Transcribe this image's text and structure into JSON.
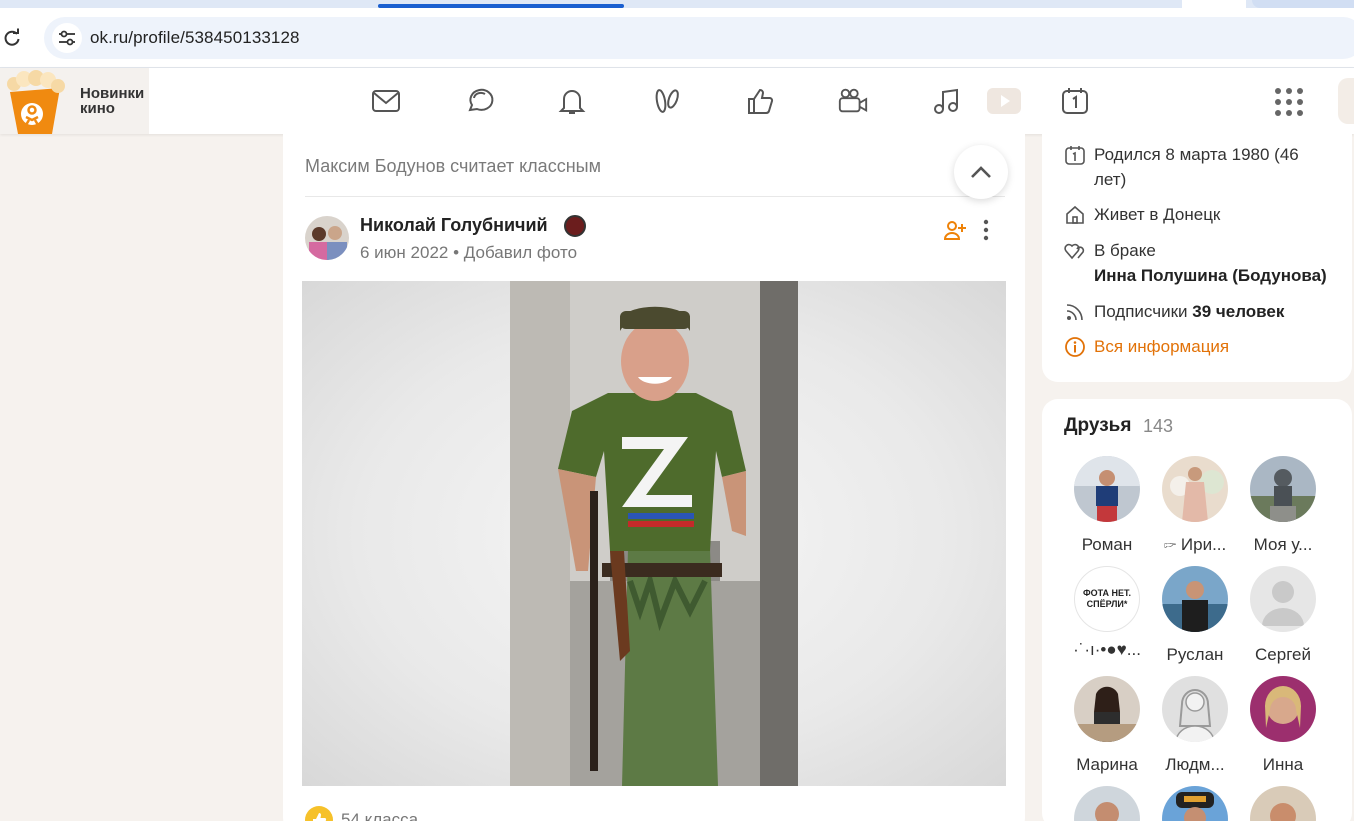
{
  "browser": {
    "url": "ok.ru/profile/538450133128"
  },
  "header": {
    "promo_text": "Новинки кино",
    "nav": [
      "messages-icon",
      "discussions-icon",
      "notifications-icon",
      "guests-icon",
      "likes-icon",
      "videocalls-icon",
      "music-icon",
      "video-icon",
      "calendar-icon",
      "apps-grid-icon"
    ]
  },
  "feed": {
    "liked_by": "Максим Бодунов считает классным",
    "author": "Николай Голубничий",
    "date": "6 июн 2022",
    "separator": "•",
    "action": "Добавил фото",
    "likes": "54 класса",
    "shirt_text": "Z"
  },
  "profile_info": {
    "born": "Родился 8 марта 1980 (46 лет)",
    "lives": "Живет в Донецк",
    "status": "В браке",
    "spouse": "Инна Полушина (Бодунова)",
    "subscribers_label": "Подписчики",
    "subscribers_value": "39 человек",
    "all_info": "Вся информация"
  },
  "friends": {
    "title": "Друзья",
    "count": "143",
    "items": [
      {
        "name": "Роман"
      },
      {
        "name": "🖙 Ири..."
      },
      {
        "name": "Моя у..."
      },
      {
        "name": "·˙·ı·•●♥..."
      },
      {
        "name": "Руслан"
      },
      {
        "name": "Сергей"
      },
      {
        "name": "Марина"
      },
      {
        "name": "Людм..."
      },
      {
        "name": "Инна"
      }
    ],
    "avatar_text": "ФОТА НЕТ. СПЁРЛИ*"
  },
  "colors": {
    "accent": "#ee8208",
    "background": "#f6f2ee",
    "link": "#e27208"
  }
}
